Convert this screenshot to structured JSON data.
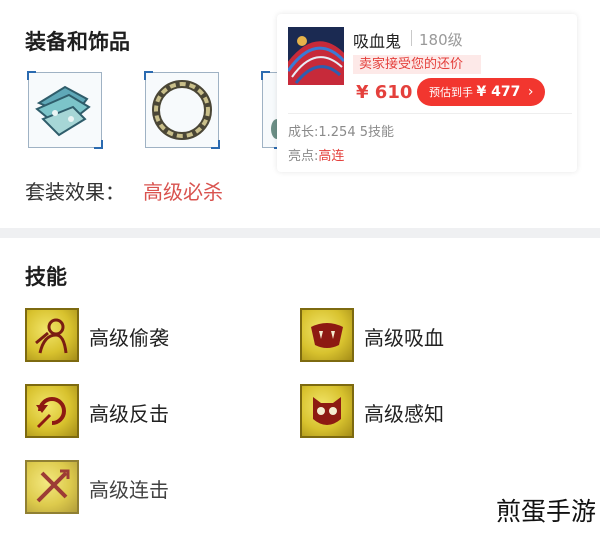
{
  "equipment": {
    "title": "装备和饰品",
    "items": [
      {
        "icon": "bracer-icon"
      },
      {
        "icon": "ring-icon"
      },
      {
        "icon": "partial-item-icon"
      }
    ],
    "set_effect_label": "套装效果：",
    "set_effect_value": "高级必杀"
  },
  "product_card": {
    "name": "吸血鬼",
    "level": "180级",
    "bargain_tag": "卖家接受您的还价",
    "price": "¥ 610",
    "estimate_label": "预估到手",
    "estimate_amount": "¥ 477",
    "growth": "成长:1.254 5技能",
    "highlight_label": "亮点:",
    "highlight_value": "高连"
  },
  "skills": {
    "title": "技能",
    "items": [
      {
        "label": "高级偷袭",
        "icon": "sneak-attack-icon"
      },
      {
        "label": "高级吸血",
        "icon": "vampire-icon"
      },
      {
        "label": "高级反击",
        "icon": "counterattack-icon"
      },
      {
        "label": "高级感知",
        "icon": "perception-icon"
      },
      {
        "label": "高级连击",
        "icon": "combo-attack-icon"
      }
    ]
  },
  "watermark": "煎蛋手游",
  "colors": {
    "accent_red": "#e4403c",
    "button_red": "#f2362f",
    "skill_icon_gold": "#d8c22e",
    "section_gap": "#eff0f2"
  }
}
